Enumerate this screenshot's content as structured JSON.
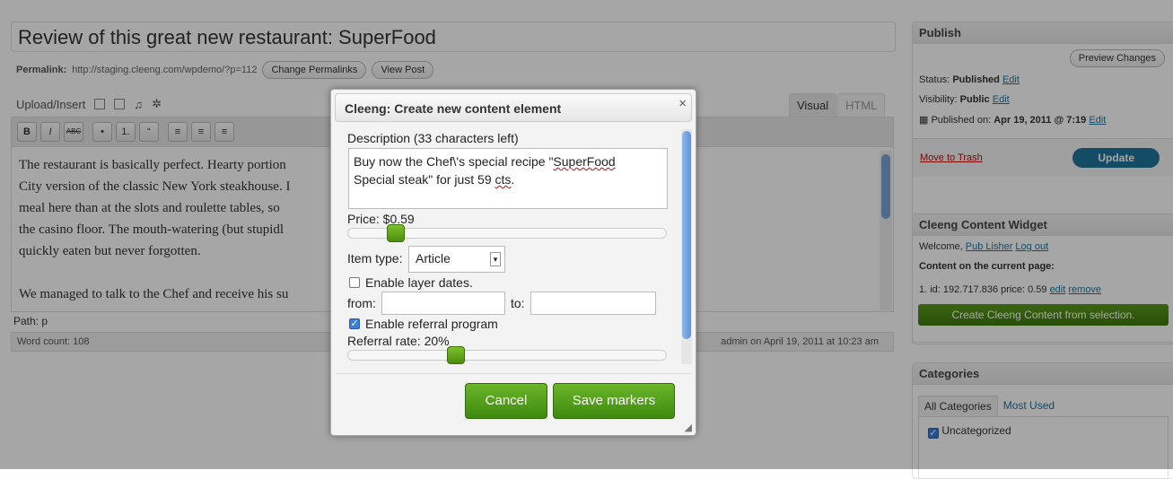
{
  "editor": {
    "title": "Review of this great new restaurant: SuperFood",
    "permalink_label": "Permalink:",
    "permalink_url": "http://staging.cleeng.com/wpdemo/?p=112",
    "change_permalinks": "Change Permalinks",
    "view_post": "View Post",
    "upload_insert": "Upload/Insert",
    "tab_visual": "Visual",
    "tab_html": "HTML",
    "toolbar": [
      "B",
      "I",
      "ABC",
      "•",
      "1.",
      "“",
      "≡",
      "≡",
      "≡"
    ],
    "paragraphs": [
      "The restaurant is basically perfect. Hearty portion",
      "City version of the classic New York steakhouse. I",
      "meal here than at the slots and roulette tables, so",
      "the casino floor. The mouth-watering (but stupidl",
      "quickly eaten but never forgotten."
    ],
    "paragraph2": "We managed to talk to the Chef and receive his su",
    "path": "Path: p",
    "word_count": "Word count: 108",
    "last_edit": "admin on April 19, 2011 at 10:23 am"
  },
  "publish": {
    "title": "Publish",
    "preview": "Preview Changes",
    "status_label": "Status:",
    "status_value": "Published",
    "visibility_label": "Visibility:",
    "visibility_value": "Public",
    "published_label": "Published on:",
    "published_value": "Apr 19, 2011 @ 7:19",
    "edit": "Edit",
    "trash": "Move to Trash",
    "update": "Update"
  },
  "widget": {
    "title": "Cleeng Content Widget",
    "welcome": "Welcome,",
    "user": "Pub Lisher",
    "logout": "Log out",
    "content_label": "Content on the current page:",
    "item": "1. id: 192.717.836 price: 0.59",
    "edit": "edit",
    "remove": "remove",
    "create": "Create Cleeng Content from selection."
  },
  "categories": {
    "title": "Categories",
    "tab_all": "All Categories",
    "tab_used": "Most Used",
    "item": "Uncategorized"
  },
  "dialog": {
    "title": "Cleeng: Create new content element",
    "close": "×",
    "desc_label": "Description (33 characters left)",
    "desc_line1a": "Buy now the Chef\\'s special recipe \"",
    "desc_line1b": "SuperFood",
    "desc_line2a": "Special steak\" for just 59 ",
    "desc_line2b": "cts",
    "desc_line2c": ".",
    "price_label": "Price: $0.59",
    "price_fraction": 0.13,
    "item_type_label": "Item type:",
    "item_type_value": "Article",
    "enable_layer": "Enable layer dates.",
    "enable_layer_checked": false,
    "from": "from:",
    "to": "to:",
    "enable_referral": "Enable referral program",
    "enable_referral_checked": true,
    "referral_label": "Referral rate: 20%",
    "referral_fraction": 0.33,
    "cancel": "Cancel",
    "save": "Save markers"
  }
}
